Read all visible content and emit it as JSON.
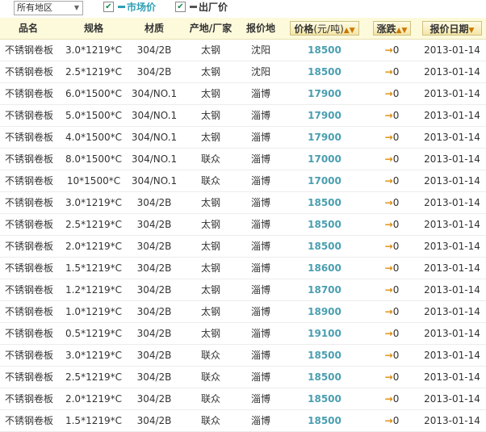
{
  "filter": {
    "region": "所有地区",
    "market_price_label": "市场价",
    "factory_price_label": "出厂价",
    "market_checked": true,
    "factory_checked": true
  },
  "colors": {
    "market": "#2e9fb5",
    "factory": "#555555",
    "price_text": "#4a9fb0",
    "arrow": "#e08a00",
    "header_bg": "#fdfadc"
  },
  "columns": {
    "name": "品名",
    "spec": "规格",
    "material": "材质",
    "origin": "产地/厂家",
    "place": "报价地",
    "price": "价格",
    "price_unit": "(元/吨)",
    "change": "涨跌",
    "date": "报价日期"
  },
  "rows": [
    {
      "name": "不锈钢卷板",
      "spec": "3.0*1219*C",
      "material": "304/2B",
      "origin": "太钢",
      "place": "沈阳",
      "price": "18500",
      "change": "0",
      "date": "2013-01-14"
    },
    {
      "name": "不锈钢卷板",
      "spec": "2.5*1219*C",
      "material": "304/2B",
      "origin": "太钢",
      "place": "沈阳",
      "price": "18500",
      "change": "0",
      "date": "2013-01-14"
    },
    {
      "name": "不锈钢卷板",
      "spec": "6.0*1500*C",
      "material": "304/NO.1",
      "origin": "太钢",
      "place": "淄博",
      "price": "17900",
      "change": "0",
      "date": "2013-01-14"
    },
    {
      "name": "不锈钢卷板",
      "spec": "5.0*1500*C",
      "material": "304/NO.1",
      "origin": "太钢",
      "place": "淄博",
      "price": "17900",
      "change": "0",
      "date": "2013-01-14"
    },
    {
      "name": "不锈钢卷板",
      "spec": "4.0*1500*C",
      "material": "304/NO.1",
      "origin": "太钢",
      "place": "淄博",
      "price": "17900",
      "change": "0",
      "date": "2013-01-14"
    },
    {
      "name": "不锈钢卷板",
      "spec": "8.0*1500*C",
      "material": "304/NO.1",
      "origin": "联众",
      "place": "淄博",
      "price": "17000",
      "change": "0",
      "date": "2013-01-14"
    },
    {
      "name": "不锈钢卷板",
      "spec": "10*1500*C",
      "material": "304/NO.1",
      "origin": "联众",
      "place": "淄博",
      "price": "17000",
      "change": "0",
      "date": "2013-01-14"
    },
    {
      "name": "不锈钢卷板",
      "spec": "3.0*1219*C",
      "material": "304/2B",
      "origin": "太钢",
      "place": "淄博",
      "price": "18500",
      "change": "0",
      "date": "2013-01-14"
    },
    {
      "name": "不锈钢卷板",
      "spec": "2.5*1219*C",
      "material": "304/2B",
      "origin": "太钢",
      "place": "淄博",
      "price": "18500",
      "change": "0",
      "date": "2013-01-14"
    },
    {
      "name": "不锈钢卷板",
      "spec": "2.0*1219*C",
      "material": "304/2B",
      "origin": "太钢",
      "place": "淄博",
      "price": "18500",
      "change": "0",
      "date": "2013-01-14"
    },
    {
      "name": "不锈钢卷板",
      "spec": "1.5*1219*C",
      "material": "304/2B",
      "origin": "太钢",
      "place": "淄博",
      "price": "18600",
      "change": "0",
      "date": "2013-01-14"
    },
    {
      "name": "不锈钢卷板",
      "spec": "1.2*1219*C",
      "material": "304/2B",
      "origin": "太钢",
      "place": "淄博",
      "price": "18700",
      "change": "0",
      "date": "2013-01-14"
    },
    {
      "name": "不锈钢卷板",
      "spec": "1.0*1219*C",
      "material": "304/2B",
      "origin": "太钢",
      "place": "淄博",
      "price": "18900",
      "change": "0",
      "date": "2013-01-14"
    },
    {
      "name": "不锈钢卷板",
      "spec": "0.5*1219*C",
      "material": "304/2B",
      "origin": "太钢",
      "place": "淄博",
      "price": "19100",
      "change": "0",
      "date": "2013-01-14"
    },
    {
      "name": "不锈钢卷板",
      "spec": "3.0*1219*C",
      "material": "304/2B",
      "origin": "联众",
      "place": "淄博",
      "price": "18500",
      "change": "0",
      "date": "2013-01-14"
    },
    {
      "name": "不锈钢卷板",
      "spec": "2.5*1219*C",
      "material": "304/2B",
      "origin": "联众",
      "place": "淄博",
      "price": "18500",
      "change": "0",
      "date": "2013-01-14"
    },
    {
      "name": "不锈钢卷板",
      "spec": "2.0*1219*C",
      "material": "304/2B",
      "origin": "联众",
      "place": "淄博",
      "price": "18500",
      "change": "0",
      "date": "2013-01-14"
    },
    {
      "name": "不锈钢卷板",
      "spec": "1.5*1219*C",
      "material": "304/2B",
      "origin": "联众",
      "place": "淄博",
      "price": "18500",
      "change": "0",
      "date": "2013-01-14"
    }
  ]
}
